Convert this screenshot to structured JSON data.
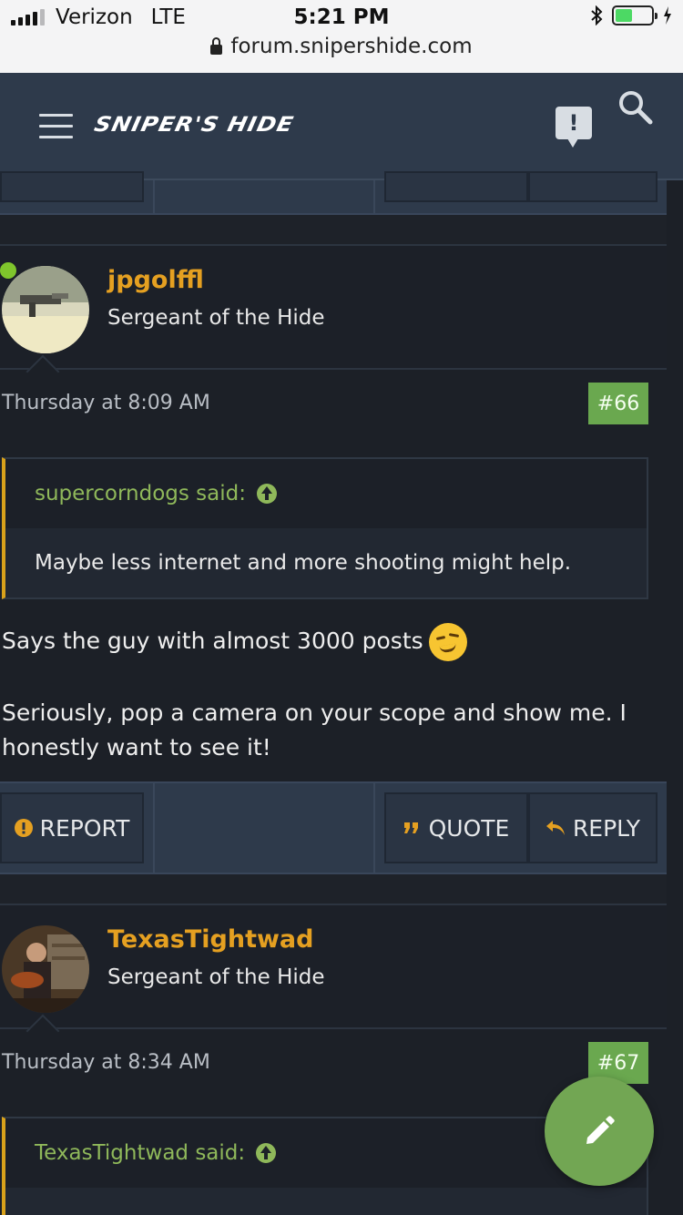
{
  "status_bar": {
    "carrier": "Verizon",
    "network": "LTE",
    "time": "5:21 PM",
    "url": "forum.snipershide.com",
    "battery_level": 0.48
  },
  "header": {
    "logo_text": "SNIPER'S HIDE"
  },
  "actions": {
    "report": "REPORT",
    "quote": "QUOTE",
    "reply": "REPLY"
  },
  "posts": [
    {
      "username": "jpgolffl",
      "user_title": "Sergeant of the Hide",
      "online": true,
      "date": "Thursday at 8:09 AM",
      "number": "#66",
      "quote_author": "supercorndogs said:",
      "quote_text": "Maybe less internet and more shooting might help.",
      "message_line1": "Says the guy with almost 3000 posts",
      "message_line2": "Seriously, pop a camera on your scope and show me. I honestly want to see it!"
    },
    {
      "username": "TexasTightwad",
      "user_title": "Sergeant of the Hide",
      "date": "Thursday at 8:34 AM",
      "number": "#67",
      "quote_author": "TexasTightwad said:"
    }
  ],
  "colors": {
    "accent_username": "#e5a021",
    "post_number_bg": "#6aa84f",
    "fab_bg": "#72a653",
    "header_bg": "#2e3a4b",
    "quote_border": "#d9a21b"
  },
  "icons": [
    "hamburger-icon",
    "alert-icon",
    "search-icon",
    "report-icon",
    "quote-icon",
    "reply-icon",
    "pencil-icon",
    "lock-icon",
    "bluetooth-icon",
    "battery-icon",
    "arrow-up-icon",
    "smirk-emoji"
  ]
}
